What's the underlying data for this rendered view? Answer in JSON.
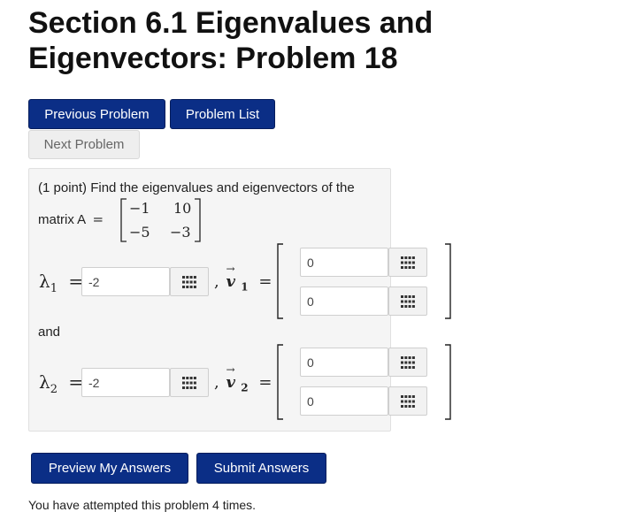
{
  "page": {
    "title": "Section 6.1 Eigenvalues and Eigenvectors: Problem 18"
  },
  "nav": {
    "previous_label": "Previous Problem",
    "list_label": "Problem List",
    "next_label": "Next Problem"
  },
  "problem": {
    "points": "(1 point)",
    "prompt": "Find the eigenvalues and eigenvectors of the",
    "matrix_label": "matrix A",
    "equals": "=",
    "matrix": [
      [
        "−1",
        "10"
      ],
      [
        "−5",
        "−3"
      ]
    ],
    "and_label": "and",
    "lambda1_label": "λ",
    "lambda1_sub": "1",
    "lambda1_value": "-2",
    "v1_label": "v",
    "v1_sub": "1",
    "v1_values": [
      "0",
      "0"
    ],
    "lambda2_label": "λ",
    "lambda2_sub": "2",
    "lambda2_value": "-2",
    "v2_label": "v",
    "v2_sub": "2",
    "v2_values": [
      "0",
      "0"
    ],
    "comma": ","
  },
  "actions": {
    "preview_label": "Preview My Answers",
    "submit_label": "Submit Answers"
  },
  "footer": {
    "attempts_text": "You have attempted this problem 4 times."
  },
  "colors": {
    "primary": "#0b2e86",
    "panel_bg": "#f5f5f5"
  }
}
